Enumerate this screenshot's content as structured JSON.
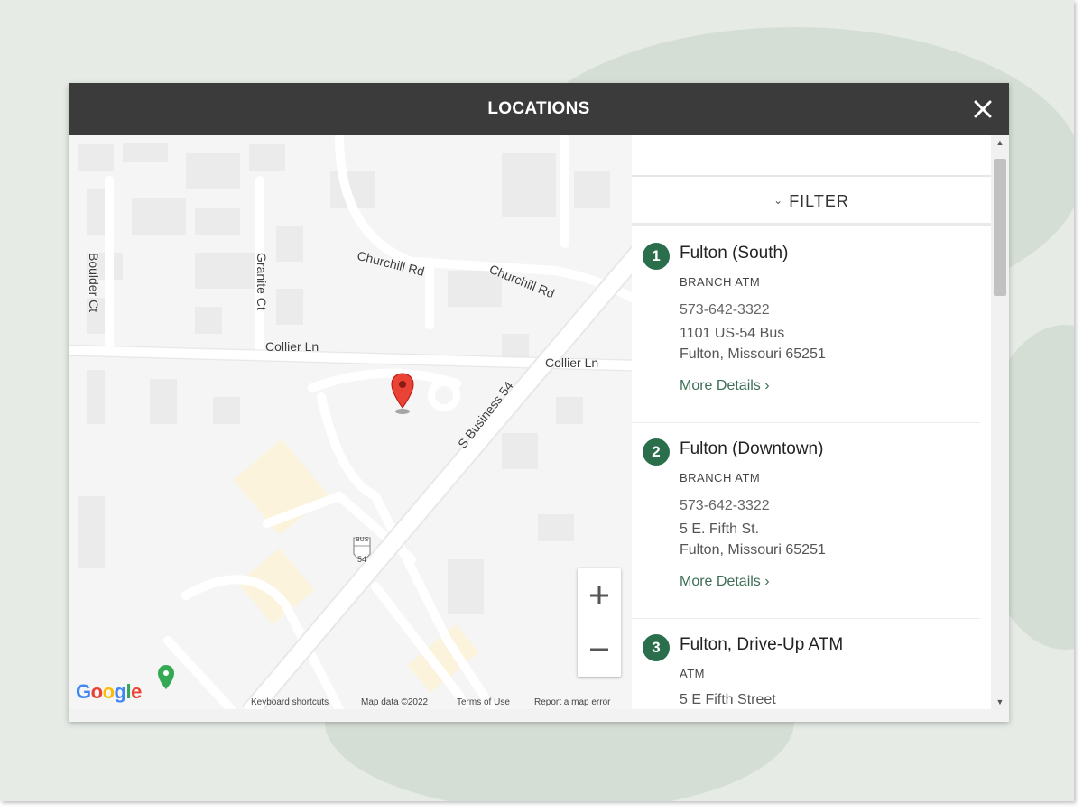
{
  "modal": {
    "title": "LOCATIONS",
    "close_icon": "close-icon"
  },
  "map": {
    "streets": {
      "churchill_1": "Churchill Rd",
      "churchill_2": "Churchill Rd",
      "collier_1": "Collier Ln",
      "collier_2": "Collier Ln",
      "boulder": "Boulder Ct",
      "granite": "Granite Ct",
      "business54": "S Business 54"
    },
    "zoom_in": "+",
    "zoom_out": "−",
    "footer": {
      "google": "Google",
      "keyboard": "Keyboard shortcuts",
      "map_data": "Map data ©2022",
      "terms": "Terms of Use",
      "report": "Report a map error"
    },
    "marker_icon": "map-pin-icon"
  },
  "filter": {
    "label": "FILTER",
    "icon": "chevron-down-icon"
  },
  "locations": [
    {
      "num": "1",
      "name": "Fulton (South)",
      "types": "BRANCH  ATM",
      "phone": "573-642-3322",
      "addr1": "1101 US-54 Bus",
      "addr2": "Fulton, Missouri 65251",
      "more": "More Details  ›"
    },
    {
      "num": "2",
      "name": "Fulton (Downtown)",
      "types": "BRANCH  ATM",
      "phone": "573-642-3322",
      "addr1": "5 E. Fifth St.",
      "addr2": "Fulton, Missouri 65251",
      "more": "More Details  ›"
    },
    {
      "num": "3",
      "name": "Fulton, Drive-Up ATM",
      "types": "ATM",
      "phone": "",
      "addr1": "5 E Fifth Street",
      "addr2": "",
      "more": ""
    }
  ],
  "colors": {
    "header": "#3b3b3b",
    "accent_green": "#2b6e4c",
    "marker_red": "#ea4335"
  }
}
